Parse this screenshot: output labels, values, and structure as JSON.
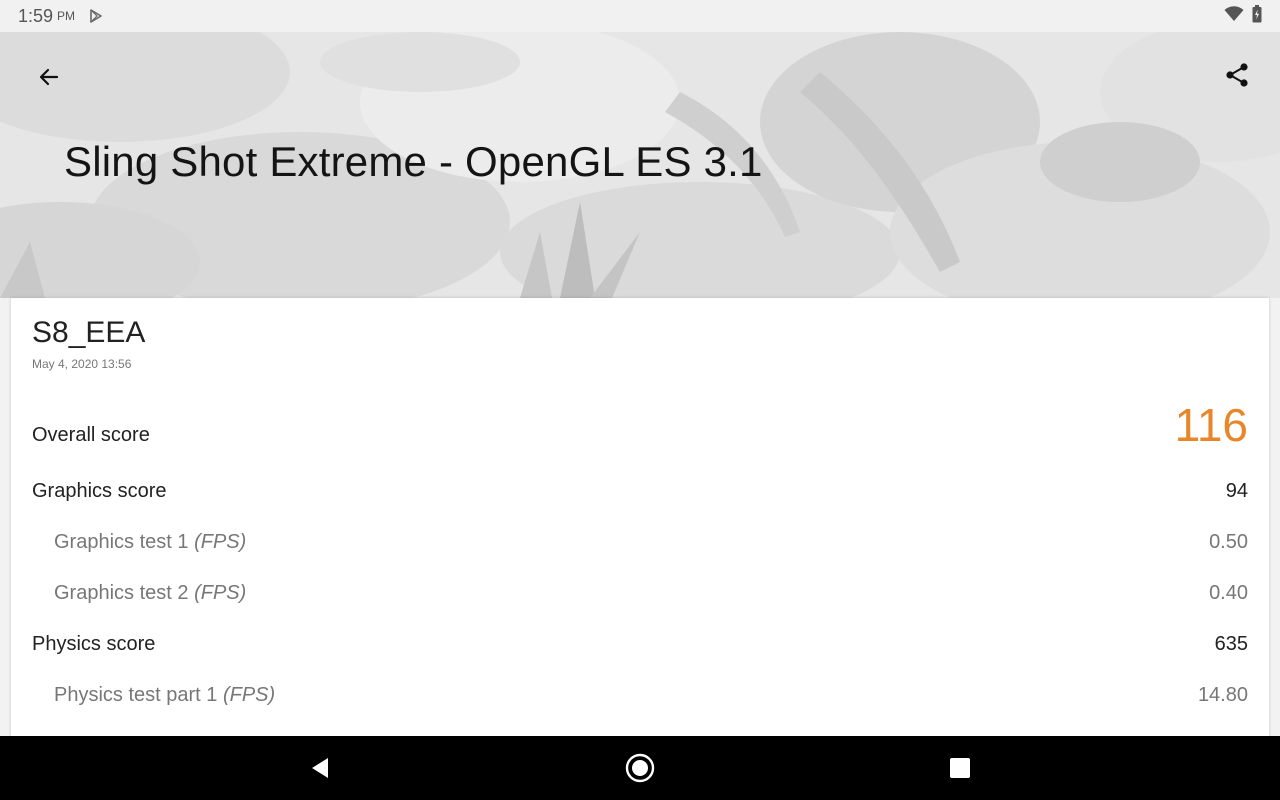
{
  "status_bar": {
    "time": "1:59",
    "ampm": "PM",
    "icons": [
      "play-store-icon",
      "wifi-icon",
      "battery-icon"
    ]
  },
  "header": {
    "title": "Sling Shot Extreme - OpenGL ES 3.1",
    "icons": [
      "back-arrow-icon",
      "share-icon"
    ]
  },
  "result": {
    "device": "S8_EEA",
    "date": "May 4, 2020 13:56",
    "accent_color": "#e8862a",
    "overall": {
      "label": "Overall score",
      "value": "116"
    },
    "graphics": {
      "label": "Graphics score",
      "value": "94"
    },
    "graphics_test_1": {
      "label": "Graphics test 1",
      "unit": "(FPS)",
      "value": "0.50"
    },
    "graphics_test_2": {
      "label": "Graphics test 2",
      "unit": "(FPS)",
      "value": "0.40"
    },
    "physics": {
      "label": "Physics score",
      "value": "635"
    },
    "physics_test_1": {
      "label": "Physics test part 1",
      "unit": "(FPS)",
      "value": "14.80"
    }
  },
  "nav_bar": {
    "icons": [
      "nav-back-icon",
      "nav-home-icon",
      "nav-recents-icon"
    ]
  }
}
